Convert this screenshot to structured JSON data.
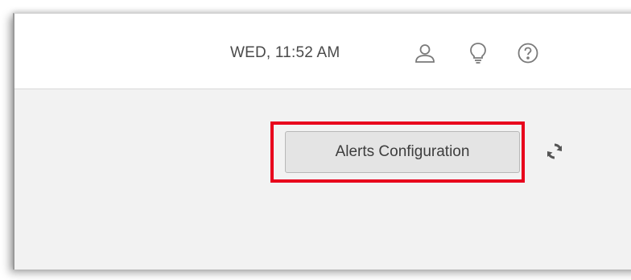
{
  "header": {
    "datetime": "WED, 11:52 AM",
    "icons": {
      "user": "user-icon",
      "tips": "lightbulb-icon",
      "help": "help-icon"
    }
  },
  "main": {
    "alerts_button_label": "Alerts Configuration",
    "refresh_icon": "refresh-icon",
    "highlight_color": "#e8001c"
  }
}
